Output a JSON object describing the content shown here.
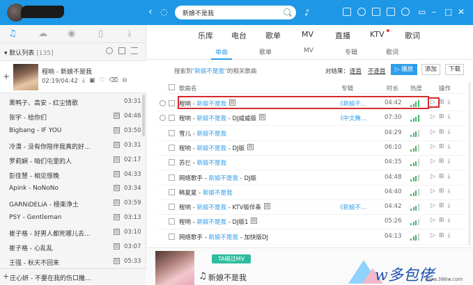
{
  "search": {
    "query": "新娘不是我"
  },
  "main_nav": [
    "乐库",
    "电台",
    "歌单",
    "MV",
    "直播",
    "KTV",
    "歌词"
  ],
  "sub_tabs": [
    "单曲",
    "歌单",
    "MV",
    "专辑",
    "歌词"
  ],
  "left_panel": {
    "list_title": "默认列表",
    "list_count": "[135]",
    "now_playing": {
      "title": "程响 - 新娘不是我",
      "time": "02:19/04:42"
    },
    "songs": [
      {
        "title": "黑鸭子、高安 - 红尘情歌",
        "duration": "03:31",
        "mv": false
      },
      {
        "title": "张宇 - 给你们",
        "duration": "04:46",
        "mv": true
      },
      {
        "title": "Bigbang - IF YOU",
        "duration": "03:50",
        "mv": true
      },
      {
        "title": "冷漠 - 没有你陪伴我真的好...",
        "duration": "03:31",
        "mv": true
      },
      {
        "title": "罗莉娴 - 咱们屯里的人",
        "duration": "02:17",
        "mv": true
      },
      {
        "title": "彭佳慧 - 相见恨晚",
        "duration": "04:33",
        "mv": true
      },
      {
        "title": "Apink - NoNoNo",
        "duration": "03:34",
        "mv": true
      },
      {
        "title": "GARNiDELiA - 極楽浄土",
        "duration": "03:59",
        "mv": true
      },
      {
        "title": "PSY - Gentleman",
        "duration": "03:13",
        "mv": true
      },
      {
        "title": "崔子格 - 好男人都死哪儿去...",
        "duration": "03:10",
        "mv": true
      },
      {
        "title": "崔子格 - 心乱乱",
        "duration": "03:07",
        "mv": true
      },
      {
        "title": "王强 - 秋天不回来",
        "duration": "05:33",
        "mv": true
      }
    ],
    "bottom_item": "庄心妍 - 不要在我的伤口撒..."
  },
  "result": {
    "prefix": "搜索到",
    "keyword": "\"新娘不是我\"",
    "suffix": "的相关歌曲",
    "filter_label": "对结果：",
    "filter_keep": "逐首",
    "filter_exclude": "不逐首",
    "play_label": "播放",
    "add_label": "添加",
    "download_label": "下载"
  },
  "table": {
    "headers": {
      "name": "歌曲名",
      "album": "专辑",
      "duration": "时长",
      "heat": "热度",
      "ops": "操作"
    },
    "rows": [
      {
        "artist": "程响 - ",
        "song": "新娘不是我",
        "suffix": "",
        "album": "《新娘不...",
        "duration": "04:42",
        "heat": 4,
        "mv": true,
        "radio": true
      },
      {
        "artist": "程响 - ",
        "song": "新娘不是我",
        "suffix": " - DJ威威版",
        "album": "《中文舞...",
        "duration": "07:30",
        "heat": 4,
        "mv": true,
        "radio": true
      },
      {
        "artist": "雪儿 - ",
        "song": "新娘不是我",
        "suffix": "",
        "album": "",
        "duration": "04:29",
        "heat": 3,
        "mv": false,
        "radio": false
      },
      {
        "artist": "程响 - ",
        "song": "新娘不是我",
        "suffix": " - DJ版",
        "album": "",
        "duration": "06:10",
        "heat": 3,
        "mv": true,
        "radio": false
      },
      {
        "artist": "苏仨 - ",
        "song": "新娘不是我",
        "suffix": "",
        "album": "",
        "duration": "04:35",
        "heat": 3,
        "mv": false,
        "radio": false
      },
      {
        "artist": "网络歌手 - ",
        "song": "新娘不是我",
        "suffix": " - DJ版",
        "album": "",
        "duration": "04:48",
        "heat": 3,
        "mv": false,
        "radio": false
      },
      {
        "artist": "韩夏夏 - ",
        "song": "新娘不是我",
        "suffix": "",
        "album": "",
        "duration": "04:40",
        "heat": 3,
        "mv": false,
        "radio": false
      },
      {
        "artist": "程响 - ",
        "song": "新娘不是我",
        "suffix": " - KTV版伴奏",
        "album": "《新娘不...",
        "duration": "04:42",
        "heat": 3,
        "mv": true,
        "radio": false
      },
      {
        "artist": "程响 - ",
        "song": "新娘不是我",
        "suffix": " - DJ版1",
        "album": "",
        "duration": "05:26",
        "heat": 3,
        "mv": true,
        "radio": false
      },
      {
        "artist": "网络歌手 - ",
        "song": "新娘不是我",
        "suffix": " - 加快版DJ",
        "album": "",
        "duration": "04:13",
        "heat": 3,
        "mv": false,
        "radio": false
      }
    ]
  },
  "mv_panel": {
    "badge": "TA唱过MV",
    "title": "新娘不是我"
  },
  "watermark": {
    "text": "w多包佬",
    "url": "www.386w.com"
  },
  "colors": {
    "accent": "#2f9de8",
    "topbar": "#1d97e6",
    "highlight_box": "#d52a2a",
    "heat": "#41b96a"
  }
}
